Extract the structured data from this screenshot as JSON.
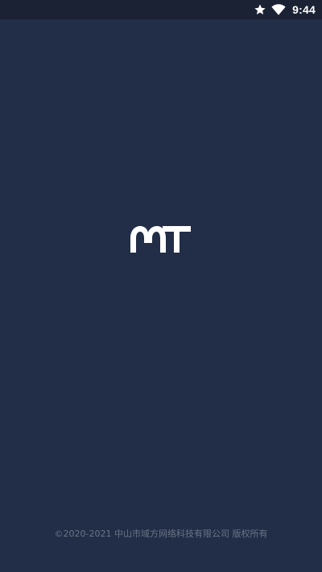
{
  "status_bar": {
    "time": "9:44",
    "icons": [
      "star-icon",
      "wifi-icon"
    ]
  },
  "logo": {
    "name": "app-logo"
  },
  "footer": {
    "copyright": "©2020-2021 中山市域方网络科技有限公司 版权所有"
  },
  "colors": {
    "background": "#222e48",
    "status_bar": "#1a2233",
    "logo": "#ffffff",
    "footer_text": "#6a7485"
  }
}
